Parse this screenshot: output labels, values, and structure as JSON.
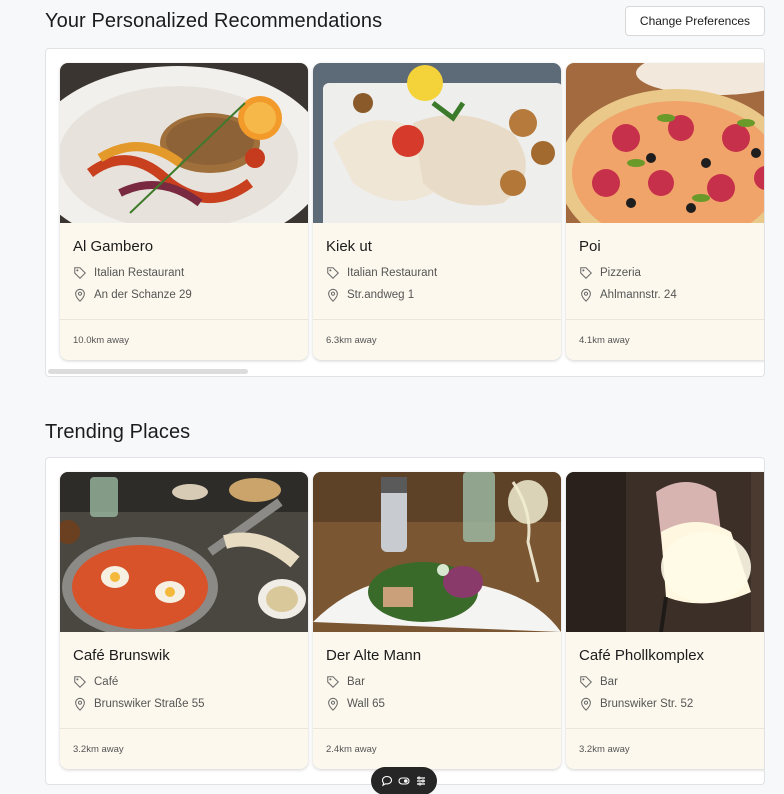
{
  "recommendations": {
    "title": "Your Personalized Recommendations",
    "change_preferences_label": "Change Preferences",
    "cards": [
      {
        "name": "Al Gambero",
        "category": "Italian Restaurant",
        "address": "An der Schanze 29",
        "distance": "10.0km away"
      },
      {
        "name": "Kiek ut",
        "category": "Italian Restaurant",
        "address": "Str.andweg 1",
        "distance": "6.3km away"
      },
      {
        "name": "Poi",
        "category": "Pizzeria",
        "address": "Ahlmannstr. 24",
        "distance": "4.1km away"
      }
    ]
  },
  "trending": {
    "title": "Trending Places",
    "cards": [
      {
        "name": "Café Brunswik",
        "category": "Café",
        "address": "Brunswiker Straße 55",
        "distance": "3.2km away"
      },
      {
        "name": "Der Alte Mann",
        "category": "Bar",
        "address": "Wall 65",
        "distance": "2.4km away"
      },
      {
        "name": "Café Phollkomplex",
        "category": "Bar",
        "address": "Brunswiker Str. 52",
        "distance": "3.2km away"
      }
    ]
  },
  "toolbar": {
    "icons": [
      "chat-icon",
      "toggle-icon",
      "menu-icon"
    ]
  },
  "colors": {
    "card_bg": "#fcf8ed",
    "page_bg": "#f7f8fa",
    "toolbar_bg": "#262626"
  }
}
